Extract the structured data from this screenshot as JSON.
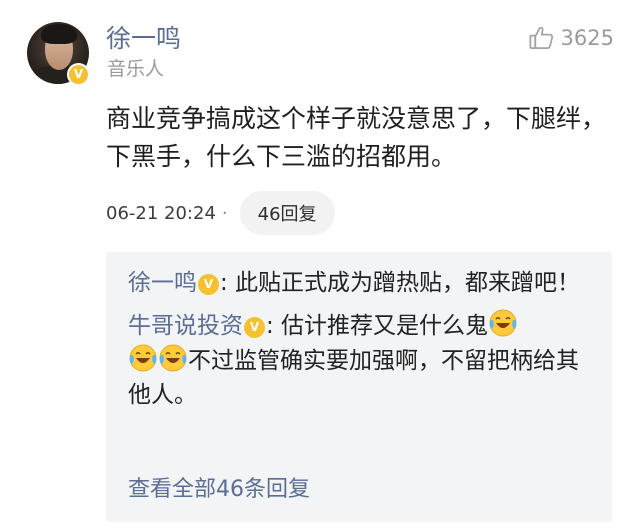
{
  "comment": {
    "author": "徐一鸣",
    "author_role": "音乐人",
    "verified_mark": "V",
    "likes": "3625",
    "text": "商业竞争搞成这个样子就没意思了，下腿绊，下黑手，什么下三滥的招都用。",
    "timestamp": "06-21 20:24",
    "separator": "·",
    "reply_count_label": "46回复"
  },
  "replies": [
    {
      "author": "徐一鸣",
      "colon": ":",
      "text": " 此贴正式成为蹭热贴，都来蹭吧！"
    },
    {
      "author": "牛哥说投资",
      "colon": ":",
      "text_1": " 估计推荐又是什么鬼",
      "text_2": "不过监管确实要加强啊，不留把柄给其他人。"
    }
  ],
  "view_all_label": "查看全部46条回复",
  "colors": {
    "link_blue": "#5b6d95",
    "verified_gold": "#f6c12c",
    "reply_bg": "#f3f4f6",
    "muted": "#9a9a9a"
  },
  "icons": {
    "like": "thumbs-up-icon",
    "emoji": "laugh-cry-emoji-icon"
  }
}
